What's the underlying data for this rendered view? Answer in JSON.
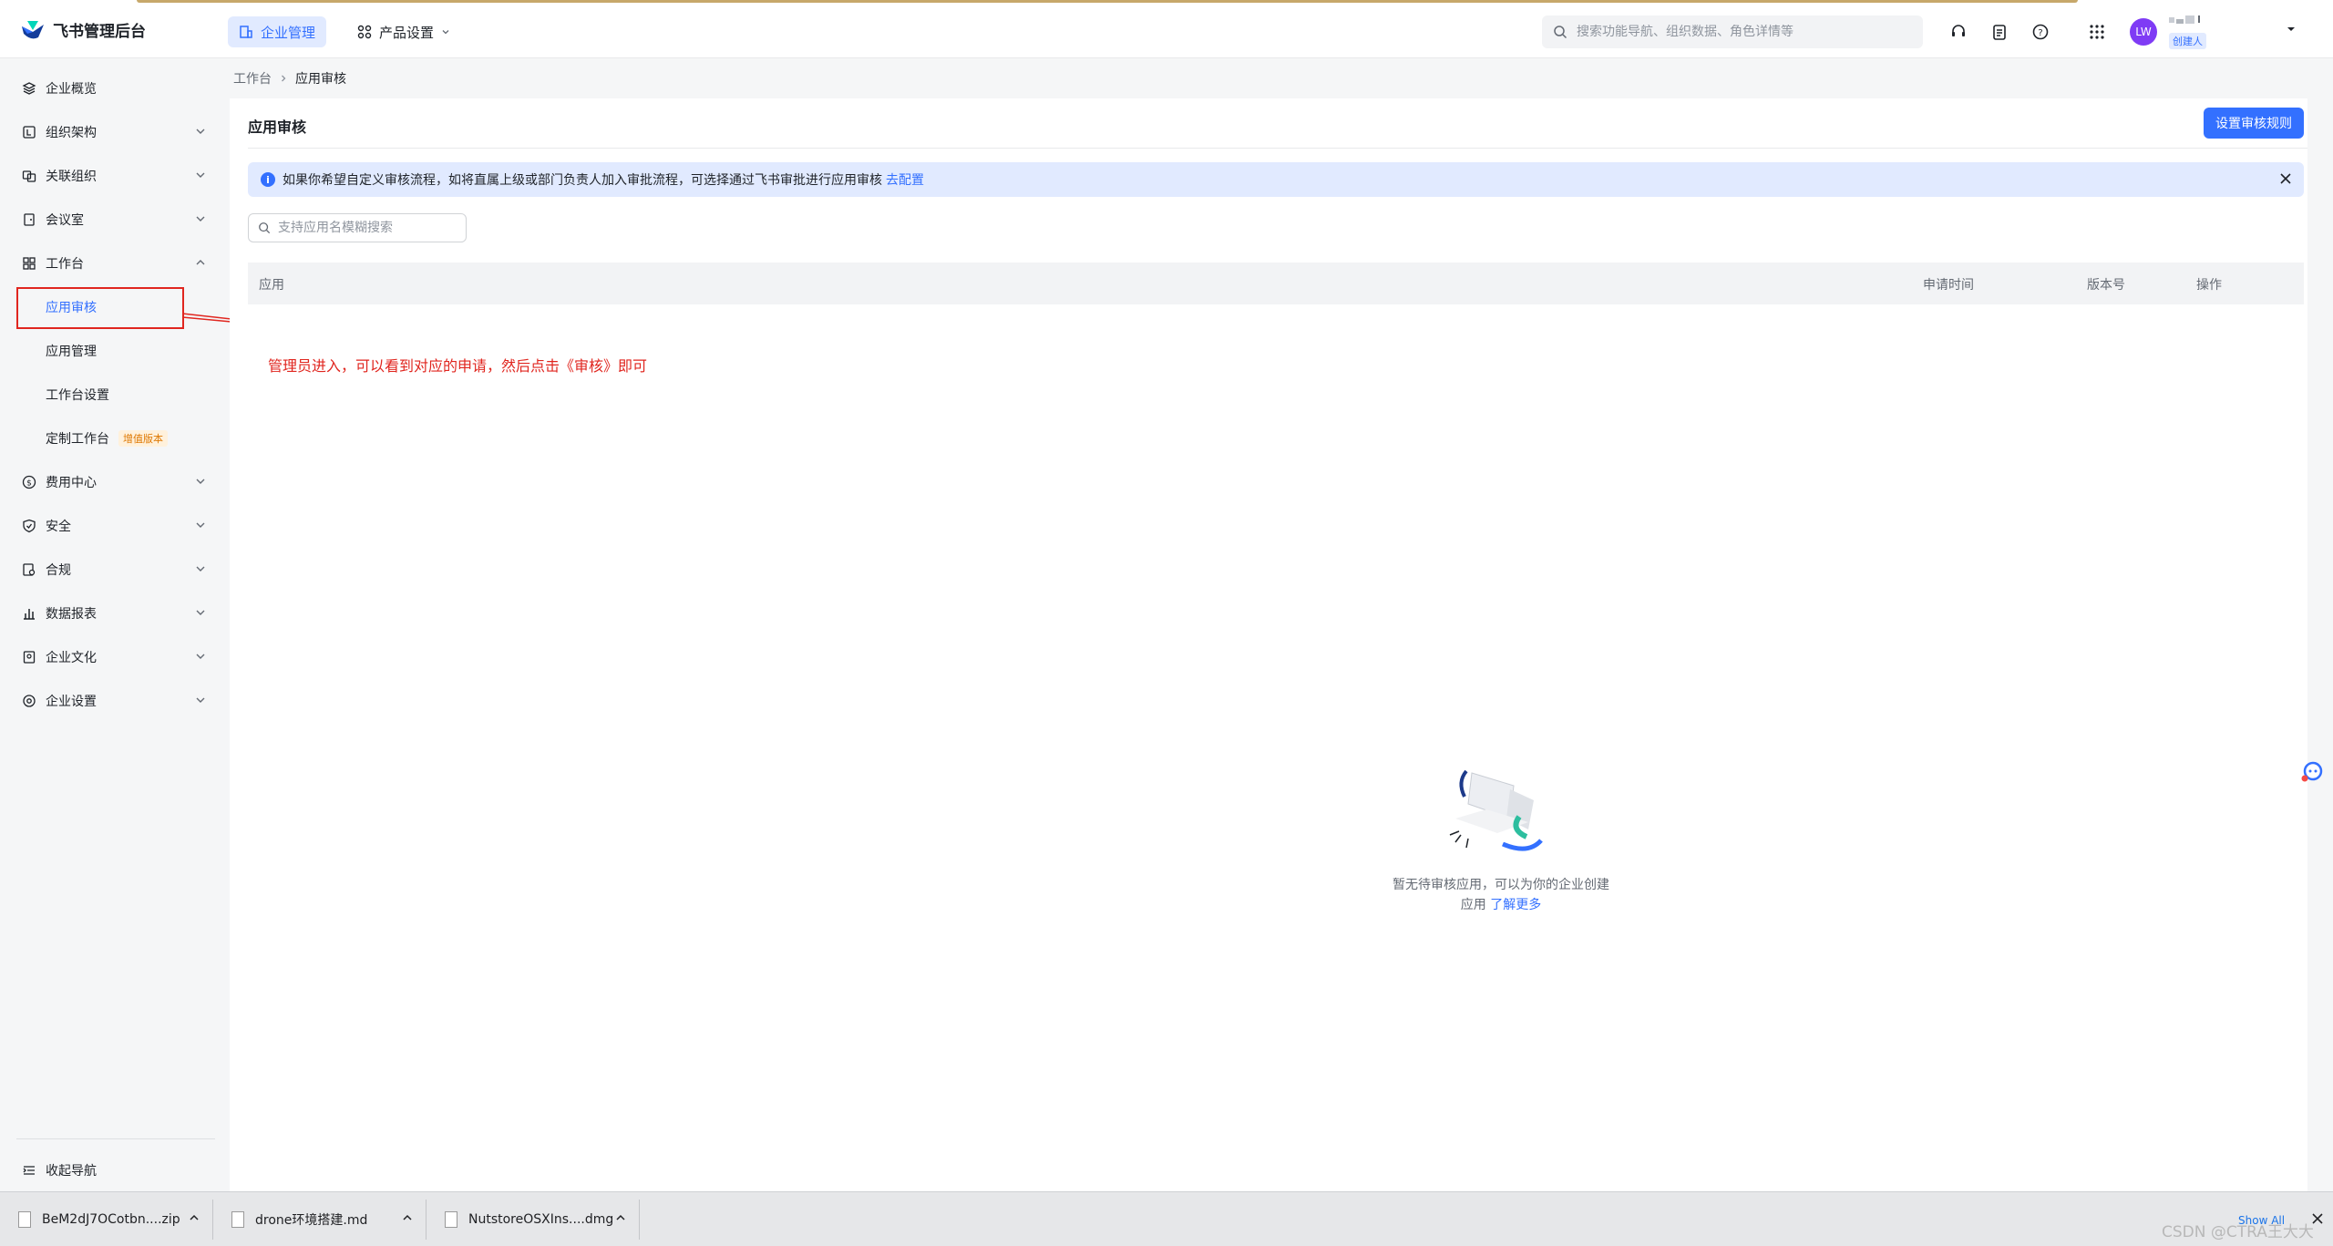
{
  "app": {
    "title": "飞书管理后台"
  },
  "header": {
    "tabs": [
      {
        "label": "企业管理"
      },
      {
        "label": "产品设置"
      }
    ],
    "search_placeholder": "搜索功能导航、组织数据、角色详情等",
    "user": {
      "avatar_initials": "LW",
      "role_badge": "创建人"
    }
  },
  "sidebar": {
    "items": [
      {
        "label": "企业概览",
        "icon": "layers-icon"
      },
      {
        "label": "组织架构",
        "icon": "org-icon"
      },
      {
        "label": "关联组织",
        "icon": "link-org-icon"
      },
      {
        "label": "会议室",
        "icon": "meeting-room-icon"
      },
      {
        "label": "工作台",
        "icon": "grid-icon"
      },
      {
        "label": "费用中心",
        "icon": "dollar-icon"
      },
      {
        "label": "安全",
        "icon": "shield-icon"
      },
      {
        "label": "合规",
        "icon": "compliance-icon"
      },
      {
        "label": "数据报表",
        "icon": "chart-icon"
      },
      {
        "label": "企业文化",
        "icon": "culture-icon"
      },
      {
        "label": "企业设置",
        "icon": "gear-icon"
      }
    ],
    "workbench_sub": [
      {
        "label": "应用审核"
      },
      {
        "label": "应用管理"
      },
      {
        "label": "工作台设置"
      },
      {
        "label": "定制工作台",
        "tag": "增值版本"
      }
    ],
    "collapse_label": "收起导航"
  },
  "breadcrumb": {
    "parent": "工作台",
    "current": "应用审核"
  },
  "main": {
    "title": "应用审核",
    "primary_button": "设置审核规则",
    "alert": {
      "text": "如果你希望自定义审核流程，如将直属上级或部门负责人加入审批流程，可选择通过飞书审批进行应用审核",
      "link": "去配置"
    },
    "search_placeholder": "支持应用名模糊搜索",
    "table_columns": [
      "应用",
      "申请时间",
      "版本号",
      "操作"
    ],
    "empty_text": "暂无待审核应用，可以为你的企业创建应用",
    "empty_link": "了解更多"
  },
  "annotation": {
    "text": "管理员进入，可以看到对应的申请，然后点击《审核》即可"
  },
  "downloads": {
    "items": [
      {
        "name": "BeM2dJ7OCotbn....zip"
      },
      {
        "name": "drone环境搭建.md"
      },
      {
        "name": "NutstoreOSXIns....dmg"
      }
    ],
    "show_all": "Show All"
  },
  "watermark": "CSDN @CTRA王大大",
  "colors": {
    "accent": "#3370ff",
    "annotation": "#e0261f"
  }
}
